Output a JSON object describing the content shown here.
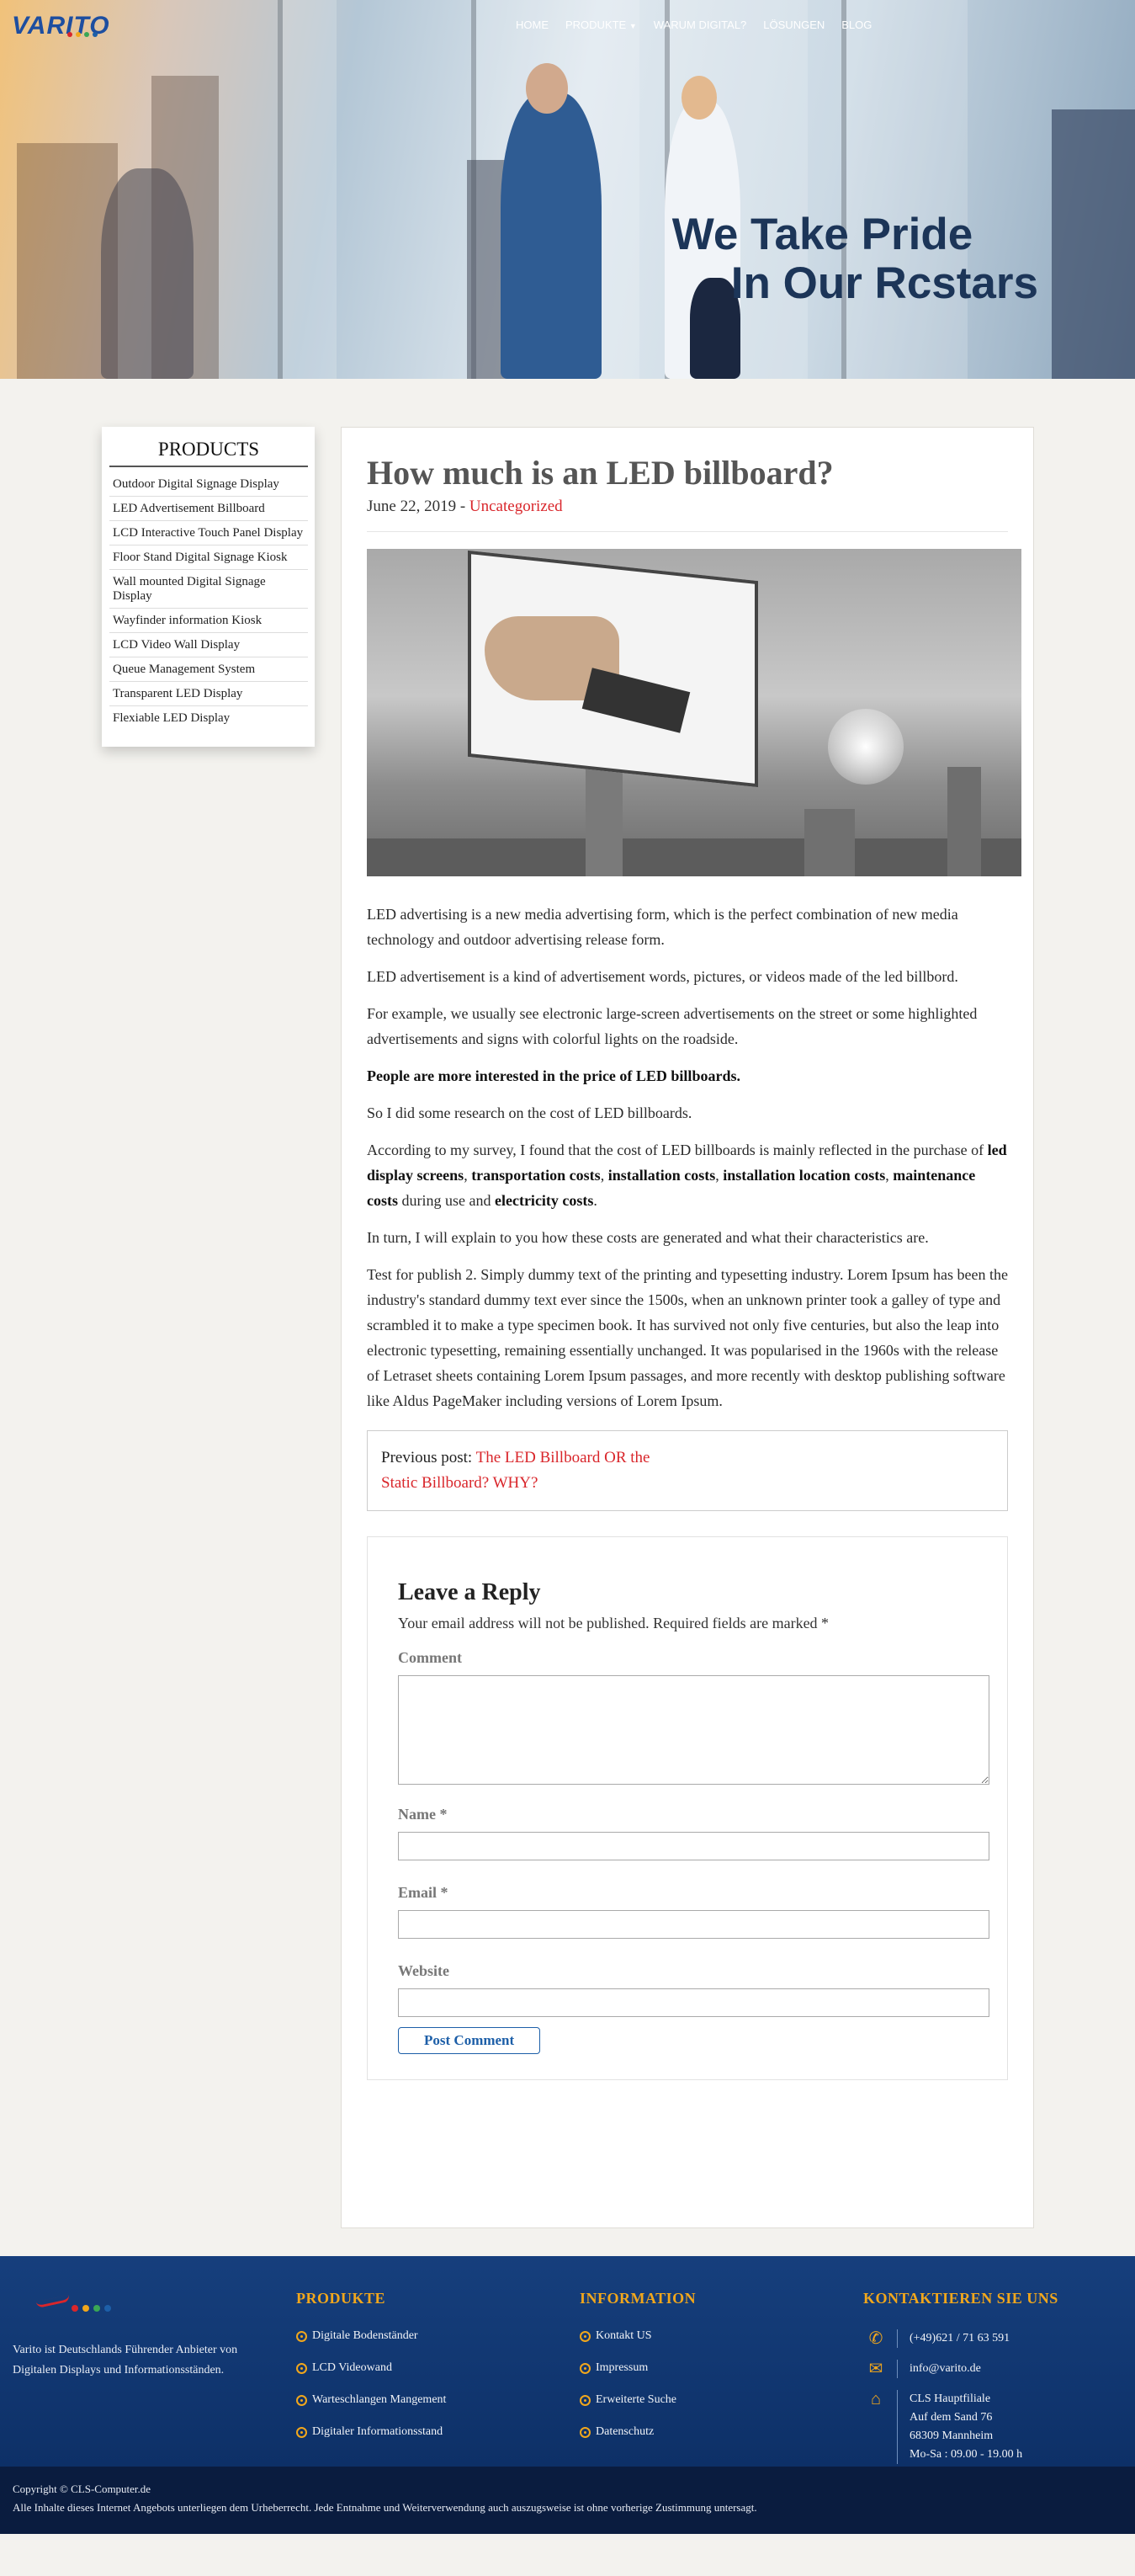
{
  "brand": {
    "logo_text": "VARITO"
  },
  "nav": {
    "items": [
      "HOME",
      "PRODUKTE",
      "WARUM DIGITAL?",
      "LÖSUNGEN",
      "BLOG"
    ],
    "dropdown_icon": "chevron-down-icon"
  },
  "hero": {
    "title_line1": "We Take Pride",
    "title_line2": "In Our Rcstars"
  },
  "sidebar": {
    "title": "PRODUCTS",
    "items": [
      "Outdoor Digital Signage Display",
      "LED Advertisement Billboard",
      "LCD Interactive Touch Panel Display",
      "Floor Stand Digital Signage Kiosk",
      "Wall mounted Digital Signage Display",
      "Wayfinder information Kiosk",
      "LCD Video Wall Display",
      "Queue Management System",
      "Transparent LED Display",
      "Flexiable LED Display"
    ]
  },
  "article": {
    "title": "How much is an LED billboard?",
    "date": "June 22, 2019",
    "separator": " - ",
    "category": "Uncategorized",
    "p1": "LED advertising is a new media advertising form, which is the perfect combination of new media technology and outdoor advertising release form.",
    "p2": "LED advertisement is a kind of advertisement words, pictures, or videos made of the led billbord.",
    "p3": "For example, we usually see electronic large-screen advertisements on the street or some highlighted advertisements and signs with colorful lights on the roadside.",
    "p4": "People are more interested in the price of LED billboards.",
    "p5": "So I did some research on the cost of LED billboards.",
    "p6": {
      "a": "According to my survey, I found that the cost of LED billboards is mainly reflected in the purchase of ",
      "b1": "led display screens",
      "c1": ", ",
      "b2": "transportation costs",
      "c2": ", ",
      "b3": "installation costs",
      "c3": ", ",
      "b4": "installation location costs",
      "c4": ", ",
      "b5": "maintenance costs",
      "c5": " during use and ",
      "b6": "electricity costs",
      "c6": "."
    },
    "p7": "In turn, I will explain to you how these costs are generated and what their characteristics are.",
    "p8": "Test for publish 2. Simply dummy text of the printing and typesetting industry. Lorem Ipsum has been the industry's standard dummy text ever since the 1500s, when an unknown printer took a galley of type and scrambled it to make a type specimen book. It has survived not only five centuries, but also the leap into electronic typesetting, remaining essentially unchanged. It was popularised in the 1960s with the release of Letraset sheets containing Lorem Ipsum passages, and more recently with desktop publishing software like Aldus PageMaker including versions of Lorem Ipsum.",
    "prev_label": "Previous post: ",
    "prev_link_line1": "The LED Billboard OR the",
    "prev_link_line2": "Static Billboard? WHY?"
  },
  "reply": {
    "title": "Leave a Reply",
    "note": "Your email address will not be published. Required fields are marked *",
    "comment_label": "Comment",
    "name_label": "Name *",
    "email_label": "Email *",
    "website_label": "Website",
    "name_value": "",
    "email_value": "",
    "website_value": "",
    "submit_label": "Post Comment"
  },
  "footer": {
    "about": "Varito ist Deutschlands Führender Anbieter von Digitalen Displays und Informationsständen.",
    "produkte_title": "PRODUKTE",
    "produkte_items": [
      "Digitale Bodenständer",
      "LCD Videowand",
      "Warteschlangen Mangement",
      "Digitaler Informationsstand"
    ],
    "info_title": "INFORMATION",
    "info_items": [
      "Kontakt US",
      "Impressum",
      "Erweiterte Suche",
      "Datenschutz"
    ],
    "contact_title": "KONTAKTIEREN SIE UNS",
    "phone": "(+49)621 / 71 63 591",
    "email": "info@varito.de",
    "addr1": "CLS Hauptfiliale",
    "addr2": "Auf dem Sand 76",
    "addr3": "68309 Mannheim",
    "addr4": "Mo-Sa : 09.00 - 19.00 h",
    "copyright": "Copyright © CLS-Computer.de",
    "legal": "Alle Inhalte dieses Internet Angebots unterliegen dem Urheberrecht. Jede Entnahme und Weiterverwendung auch auszugsweise ist ohne vorherige Zustimmung untersagt."
  },
  "colors": {
    "accent_red": "#d9262b",
    "footer_blue": "#163f7d",
    "footer_orange": "#f1a71c",
    "hero_title": "#1c3558"
  }
}
